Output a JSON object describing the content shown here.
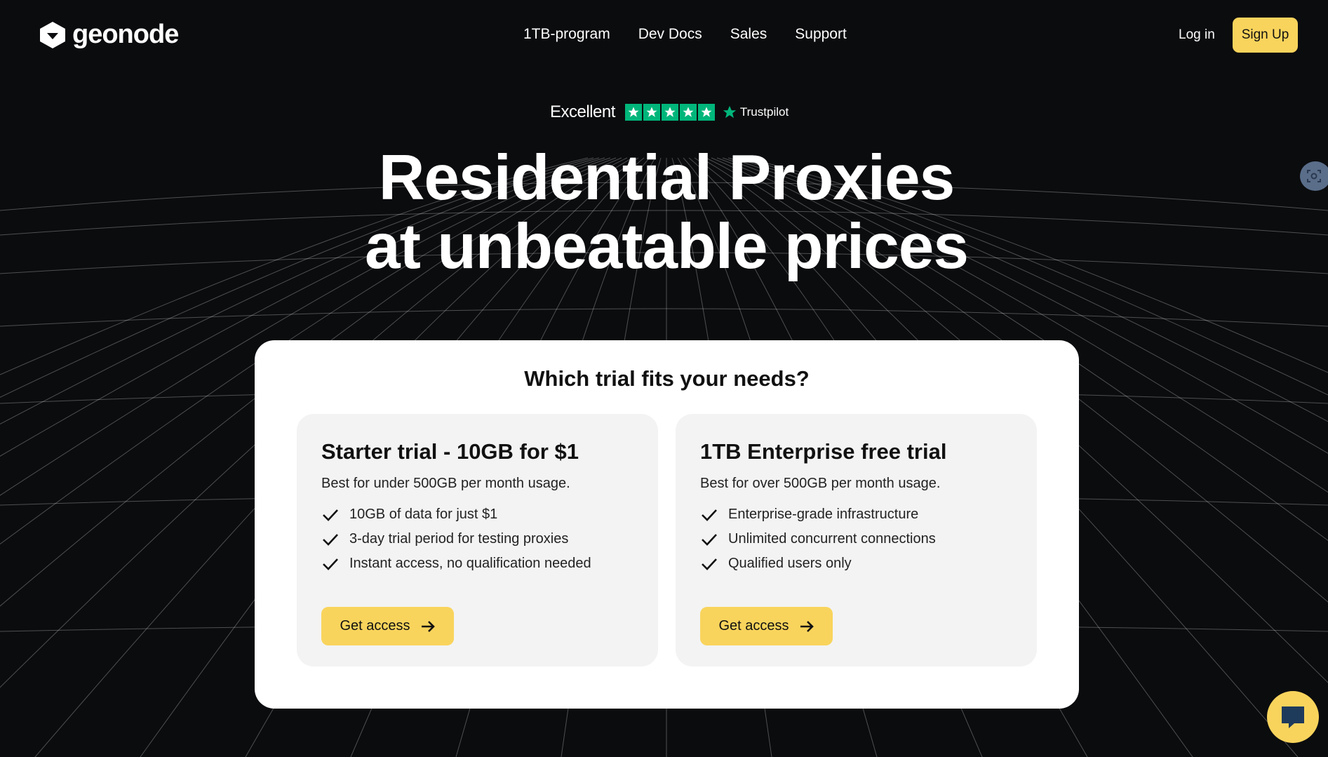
{
  "brand": {
    "name": "geonode",
    "accent": "#f9d45c",
    "trustpilot_green": "#00b67a"
  },
  "nav": {
    "items": [
      {
        "label": "1TB-program"
      },
      {
        "label": "Dev Docs"
      },
      {
        "label": "Sales"
      },
      {
        "label": "Support"
      }
    ],
    "login_label": "Log in",
    "signup_label": "Sign Up"
  },
  "trustpilot": {
    "rating_text": "Excellent",
    "stars": 5,
    "brand": "Trustpilot"
  },
  "hero": {
    "line1": "Residential Proxies",
    "line2": "at unbeatable prices"
  },
  "trials": {
    "title": "Which trial fits your needs?",
    "cards": [
      {
        "title": "Starter trial - 10GB for $1",
        "subtitle": "Best for under 500GB per month usage.",
        "features": [
          "10GB of data for just $1",
          "3-day trial period for testing proxies",
          "Instant access, no qualification needed"
        ],
        "button": "Get access"
      },
      {
        "title": "1TB Enterprise free trial",
        "subtitle": "Best for over 500GB per month usage.",
        "features": [
          "Enterprise-grade infrastructure",
          "Unlimited concurrent connections",
          "Qualified users only"
        ],
        "button": "Get access"
      }
    ]
  },
  "icons": {
    "side": "screenshot-capture-icon",
    "chat": "chat-bubble-icon"
  }
}
